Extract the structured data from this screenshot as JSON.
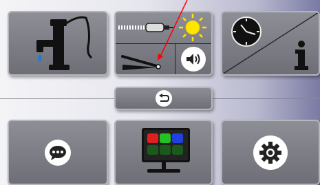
{
  "buttons": {
    "water": {
      "icon": "water-pump-icon"
    },
    "multi": {
      "icons": [
        "dental-drill-icon",
        "sun-icon",
        "foot-pedal-icon",
        "speaker-icon"
      ]
    },
    "clock_info": {
      "icons": [
        "clock-icon",
        "info-icon"
      ]
    },
    "back": {
      "icon": "back-arrow-icon"
    },
    "chat": {
      "icon": "chat-bubble-icon"
    },
    "display": {
      "icon": "display-colors-icon",
      "colors": [
        "#e02020",
        "#22c022",
        "#2040e0",
        "#1c5a1c",
        "#1c5a1c",
        "#1c5a1c"
      ]
    },
    "settings": {
      "icon": "gear-icon"
    }
  },
  "annotation": {
    "color": "#ff0000",
    "icon": "red-arrow-icon"
  }
}
